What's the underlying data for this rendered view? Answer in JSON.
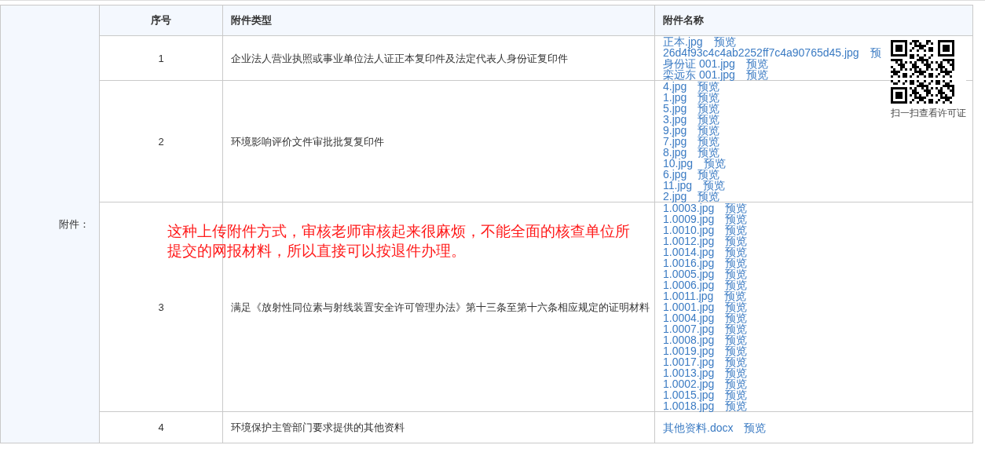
{
  "label": "附件：",
  "columns": [
    "序号",
    "附件类型",
    "附件名称"
  ],
  "rows": [
    {
      "number": "1",
      "type": "企业法人营业执照或事业单位法人证正本复印件及法定代表人身份证复印件",
      "files": [
        {
          "name": "正本.jpg",
          "preview": "预览"
        },
        {
          "name": "26d4f93c4c4ab2252ff7c4a90765d45.jpg",
          "preview": "预"
        },
        {
          "name": "身份证 001.jpg",
          "preview": "预览"
        },
        {
          "name": "栾远东 001.jpg",
          "preview": "预览"
        }
      ]
    },
    {
      "number": "2",
      "type": "环境影响评价文件审批批复复印件",
      "files": [
        {
          "name": "4.jpg",
          "preview": "预览"
        },
        {
          "name": "1.jpg",
          "preview": "预览"
        },
        {
          "name": "5.jpg",
          "preview": "预览"
        },
        {
          "name": "3.jpg",
          "preview": "预览"
        },
        {
          "name": "9.jpg",
          "preview": "预览"
        },
        {
          "name": "7.jpg",
          "preview": "预览"
        },
        {
          "name": "8.jpg",
          "preview": "预览"
        },
        {
          "name": "10.jpg",
          "preview": "预览"
        },
        {
          "name": "6.jpg",
          "preview": "预览"
        },
        {
          "name": "11.jpg",
          "preview": "预览"
        },
        {
          "name": "2.jpg",
          "preview": "预览"
        }
      ]
    },
    {
      "number": "3",
      "type": "满足《放射性同位素与射线装置安全许可管理办法》第十三条至第十六条相应规定的证明材料",
      "files": [
        {
          "name": "1.0003.jpg",
          "preview": "预览"
        },
        {
          "name": "1.0009.jpg",
          "preview": "预览"
        },
        {
          "name": "1.0010.jpg",
          "preview": "预览"
        },
        {
          "name": "1.0012.jpg",
          "preview": "预览"
        },
        {
          "name": "1.0014.jpg",
          "preview": "预览"
        },
        {
          "name": "1.0016.jpg",
          "preview": "预览"
        },
        {
          "name": "1.0005.jpg",
          "preview": "预览"
        },
        {
          "name": "1.0006.jpg",
          "preview": "预览"
        },
        {
          "name": "1.0011.jpg",
          "preview": "预览"
        },
        {
          "name": "1.0001.jpg",
          "preview": "预览"
        },
        {
          "name": "1.0004.jpg",
          "preview": "预览"
        },
        {
          "name": "1.0007.jpg",
          "preview": "预览"
        },
        {
          "name": "1.0008.jpg",
          "preview": "预览"
        },
        {
          "name": "1.0019.jpg",
          "preview": "预览"
        },
        {
          "name": "1.0017.jpg",
          "preview": "预览"
        },
        {
          "name": "1.0013.jpg",
          "preview": "预览"
        },
        {
          "name": "1.0002.jpg",
          "preview": "预览"
        },
        {
          "name": "1.0015.jpg",
          "preview": "预览"
        },
        {
          "name": "1.0018.jpg",
          "preview": "预览"
        }
      ]
    },
    {
      "number": "4",
      "type": "环境保护主管部门要求提供的其他资料",
      "files": [
        {
          "name": "其他资料.docx",
          "preview": "预览"
        }
      ]
    }
  ],
  "qr": {
    "caption": "扫一扫查看许可证"
  },
  "note": "这种上传附件方式，审核老师审核起来很麻烦，不能全面的核查单位所提交的网报材料，所以直接可以按退件办理。"
}
